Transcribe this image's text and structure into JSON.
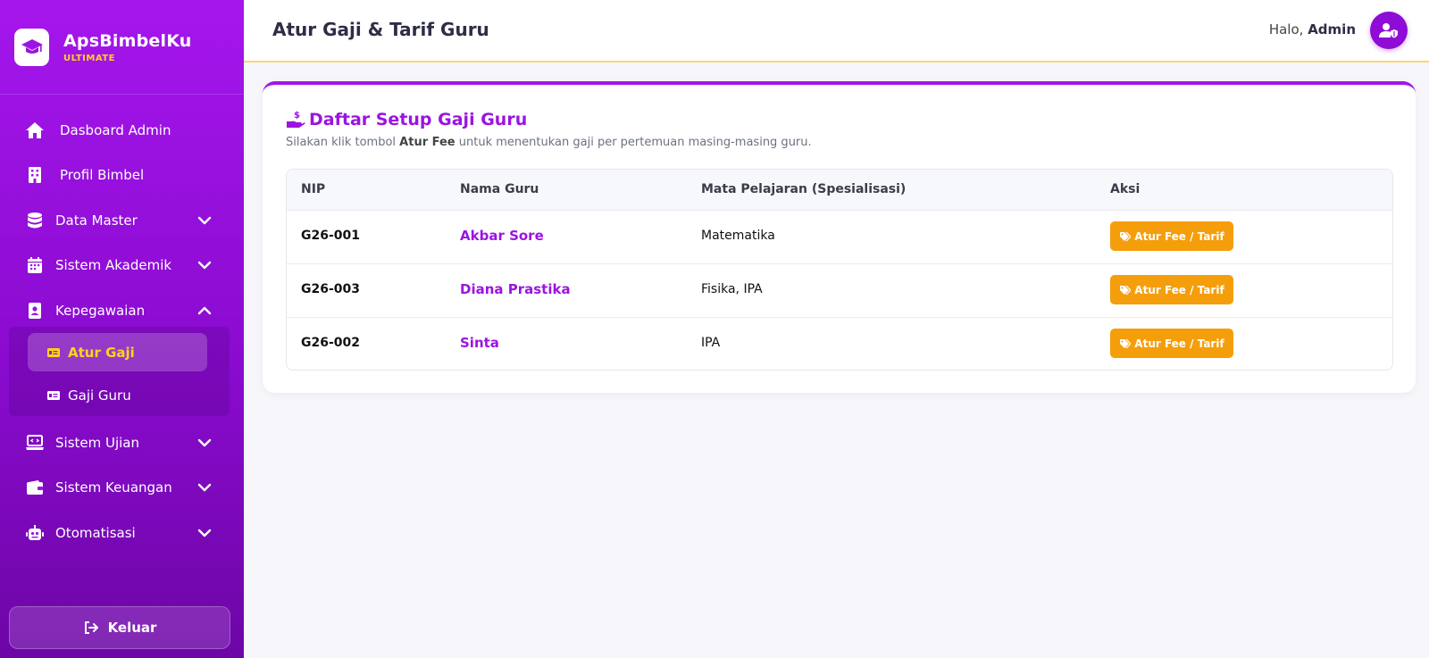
{
  "brand": {
    "name": "ApsBimbelKu",
    "subtitle": "ULTIMATE"
  },
  "sidebar": {
    "items": [
      {
        "label": "Dasboard Admin",
        "icon": "home-icon"
      },
      {
        "label": "Profil Bimbel",
        "icon": "building-icon"
      },
      {
        "label": "Data Master",
        "icon": "database-icon"
      },
      {
        "label": "Sistem Akademik",
        "icon": "calendar-icon"
      },
      {
        "label": "Kepegawaian",
        "icon": "id-badge-icon"
      },
      {
        "label": "Sistem Ujian",
        "icon": "laptop-code-icon"
      },
      {
        "label": "Sistem Keuangan",
        "icon": "wallet-icon"
      },
      {
        "label": "Otomatisasi",
        "icon": "robot-icon"
      }
    ],
    "submenu": [
      {
        "label": "Atur Gaji",
        "icon": "money-card-icon"
      },
      {
        "label": "Gaji Guru",
        "icon": "money-card-icon"
      }
    ],
    "logout_label": "Keluar"
  },
  "header": {
    "title": "Atur Gaji & Tarif Guru",
    "greeting": "Halo,",
    "user": "Admin"
  },
  "card": {
    "title": "Daftar Setup Gaji Guru",
    "desc_before": "Silakan klik tombol",
    "desc_bold": "Atur Fee",
    "desc_after": "untuk menentukan gaji per pertemuan masing-masing guru."
  },
  "table": {
    "columns": [
      "NIP",
      "Nama Guru",
      "Mata Pelajaran (Spesialisasi)",
      "Aksi"
    ],
    "rows": [
      {
        "nip": "G26-001",
        "nama": "Akbar Sore",
        "mapel": "Matematika",
        "aksi": "Atur Fee / Tarif"
      },
      {
        "nip": "G26-003",
        "nama": "Diana Prastika",
        "mapel": "Fisika, IPA",
        "aksi": "Atur Fee / Tarif"
      },
      {
        "nip": "G26-002",
        "nama": "Sinta",
        "mapel": "IPA",
        "aksi": "Atur Fee / Tarif"
      }
    ]
  },
  "colors": {
    "primary": "#9b14e0",
    "accent": "#ffd21f",
    "button": "#f59e0b"
  }
}
